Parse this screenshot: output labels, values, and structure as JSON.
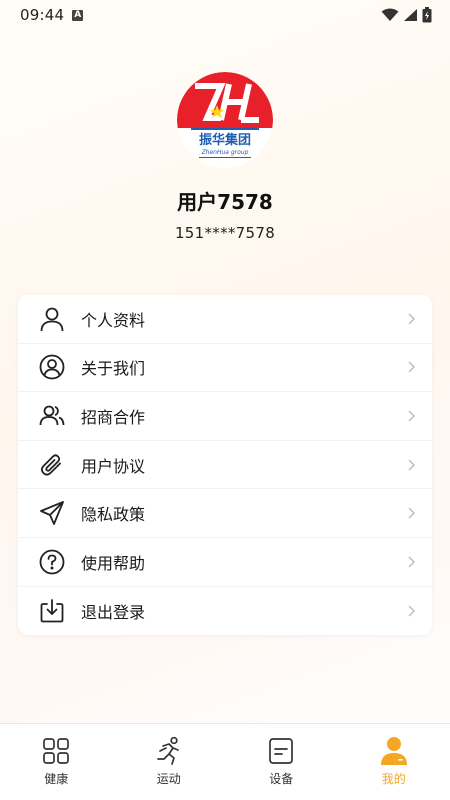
{
  "status_bar": {
    "time": "09:44",
    "notification_icon": "a-icon"
  },
  "profile": {
    "logo_text": "振华集团",
    "logo_subtext": "ZhenHua group",
    "name": "用户7578",
    "phone": "151****7578"
  },
  "menu": {
    "items": [
      {
        "label": "个人资料",
        "icon": "user-icon"
      },
      {
        "label": "关于我们",
        "icon": "user-circle-icon"
      },
      {
        "label": "招商合作",
        "icon": "users-icon"
      },
      {
        "label": "用户协议",
        "icon": "paperclip-icon"
      },
      {
        "label": "隐私政策",
        "icon": "send-icon"
      },
      {
        "label": "使用帮助",
        "icon": "help-icon"
      },
      {
        "label": "退出登录",
        "icon": "download-icon"
      }
    ]
  },
  "tabs": [
    {
      "label": "健康",
      "icon": "grid-icon"
    },
    {
      "label": "运动",
      "icon": "running-icon"
    },
    {
      "label": "设备",
      "icon": "device-icon"
    },
    {
      "label": "我的",
      "icon": "profile-icon",
      "active": true
    }
  ],
  "colors": {
    "accent": "#f5a623",
    "logo_red": "#e8202a",
    "logo_blue": "#1e5fb4"
  }
}
